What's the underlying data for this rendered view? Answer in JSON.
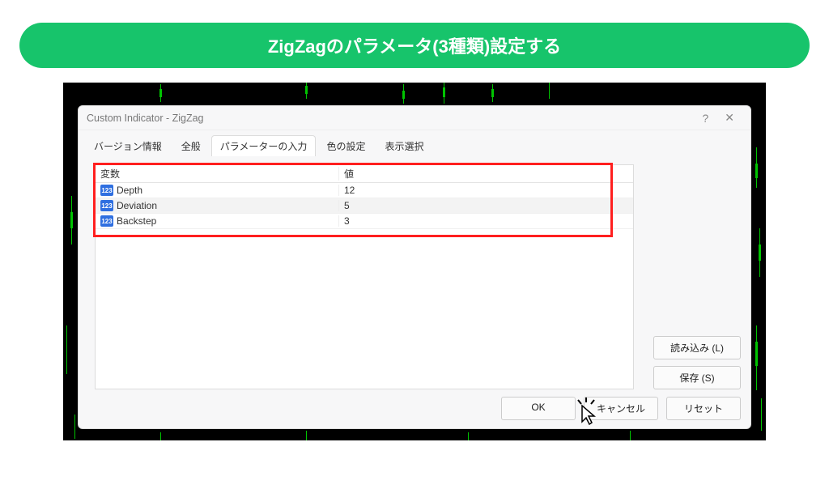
{
  "banner": {
    "title": "ZigZagのパラメータ(3種類)設定する"
  },
  "dialog": {
    "title": "Custom Indicator - ZigZag",
    "help_glyph": "?",
    "close_glyph": "✕",
    "tabs": [
      {
        "label": "バージョン情報"
      },
      {
        "label": "全般"
      },
      {
        "label": "パラメーターの入力",
        "active": true
      },
      {
        "label": "色の設定"
      },
      {
        "label": "表示選択"
      }
    ],
    "columns": {
      "name": "変数",
      "value": "値"
    },
    "rows": [
      {
        "icon": "123",
        "name": "Depth",
        "value": "12"
      },
      {
        "icon": "123",
        "name": "Deviation",
        "value": "5"
      },
      {
        "icon": "123",
        "name": "Backstep",
        "value": "3"
      }
    ],
    "buttons": {
      "load": "読み込み (L)",
      "save": "保存 (S)",
      "ok": "OK",
      "cancel": "キャンセル",
      "reset": "リセット"
    }
  }
}
